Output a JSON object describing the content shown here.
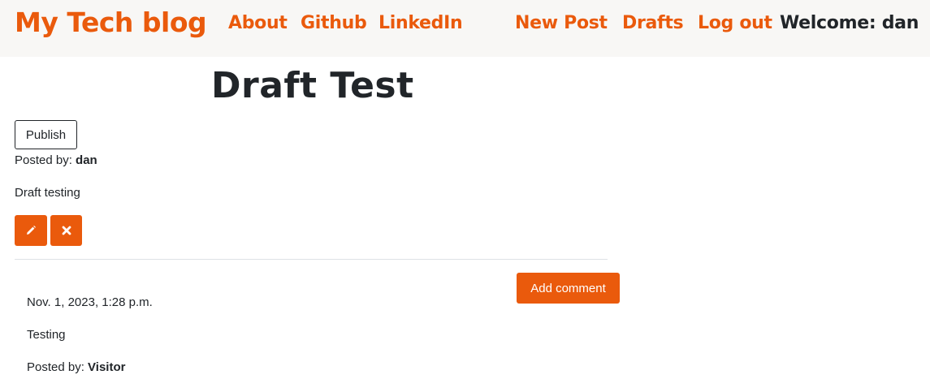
{
  "navbar": {
    "brand": "My Tech blog",
    "links": [
      "About",
      "Github",
      "LinkedIn"
    ],
    "right_links": [
      "New Post",
      "Drafts",
      "Log out"
    ],
    "welcome_prefix": "Welcome: ",
    "username": "dan"
  },
  "post": {
    "title": "Draft Test",
    "publish_label": "Publish",
    "posted_by_label": "Posted by: ",
    "author": "dan",
    "body": "Draft testing"
  },
  "comments": {
    "add_label": "Add comment",
    "items": [
      {
        "date": "Nov. 1, 2023, 1:28 p.m.",
        "text": "Testing",
        "posted_by_label": "Posted by: ",
        "author": "Visitor"
      }
    ]
  },
  "colors": {
    "accent": "#ea5a0c",
    "navbar_bg": "#f8f7f5",
    "text": "#212529"
  },
  "icons": {
    "edit": "pencil-icon",
    "delete": "times-icon"
  }
}
